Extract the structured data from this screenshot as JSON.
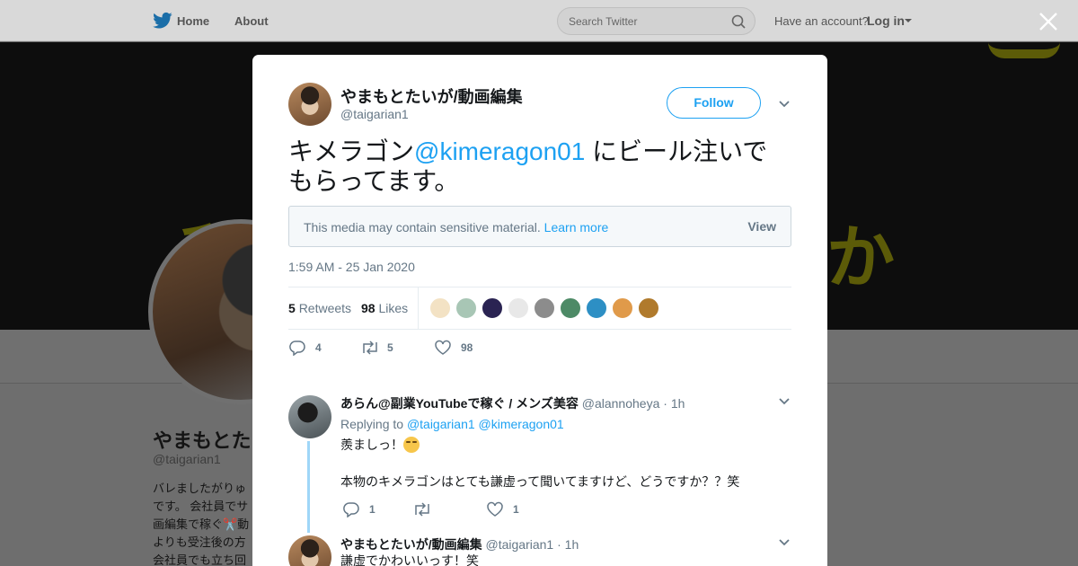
{
  "topbar": {
    "home_label": "Home",
    "about_label": "About",
    "search_placeholder": "Search Twitter",
    "have_account": "Have an account?",
    "login_label": "Log in"
  },
  "banner": {
    "text_left": "和",
    "text_right": "か"
  },
  "profile": {
    "name": "やまもとたいが",
    "handle": "@taigarian1",
    "bio": "バレましたがりゅ\nです。 会社員でサ\n画編集で稼ぐ✂️動\nよりも受注後の方\n会社員でも立ち回"
  },
  "tweet": {
    "author_name": "やまもとたいが/動画編集",
    "author_handle": "@taigarian1",
    "follow_label": "Follow",
    "text_before": "キメラゴン",
    "mention": "@kimeragon01",
    "text_after": " にビール注いでもらってます。",
    "sensitive_message": "This media may contain sensitive material.",
    "sensitive_link": "Learn more",
    "sensitive_view": "View",
    "timestamp": "1:59 AM - 25 Jan 2020",
    "retweets_count": "5",
    "retweets_label": "Retweets",
    "likes_count": "98",
    "likes_label": "Likes",
    "action_reply_count": "4",
    "action_retweet_count": "5",
    "action_like_count": "98"
  },
  "likers": [
    {
      "icon": "liker-avatar-1",
      "color": "#f3e2c4"
    },
    {
      "icon": "liker-avatar-2",
      "color": "#a8c6b5"
    },
    {
      "icon": "liker-avatar-3",
      "color": "#2a2352"
    },
    {
      "icon": "liker-avatar-4",
      "color": "#e8e8e8"
    },
    {
      "icon": "liker-avatar-5",
      "color": "#8c8c8c"
    },
    {
      "icon": "liker-avatar-6",
      "color": "#4d8a66"
    },
    {
      "icon": "liker-avatar-7",
      "color": "#2d8fc4"
    },
    {
      "icon": "liker-avatar-8",
      "color": "#e09a4a"
    },
    {
      "icon": "liker-avatar-9",
      "color": "#b07a2c"
    }
  ],
  "replies": [
    {
      "name": "あらん@副業YouTubeで稼ぐ / メンズ美容",
      "handle": "@alannoheya",
      "time": "1h",
      "replying_label": "Replying to",
      "replying_to_1": "@taigarian1",
      "replying_to_2": "@kimeragon01",
      "line1": "羨ましっ！",
      "line2": "本物のキメラゴンはとても謙虚って聞いてますけど、どうですか？？笑",
      "reply_count": "1",
      "retweet_count": "",
      "like_count": "1"
    },
    {
      "name": "やまもとたいが/動画編集",
      "handle": "@taigarian1",
      "time": "1h",
      "line1": "謙虚でかわいいっす！笑"
    }
  ],
  "colors": {
    "accent": "#1da1f2",
    "muted": "#657786",
    "thread": "#9fd6f8"
  }
}
